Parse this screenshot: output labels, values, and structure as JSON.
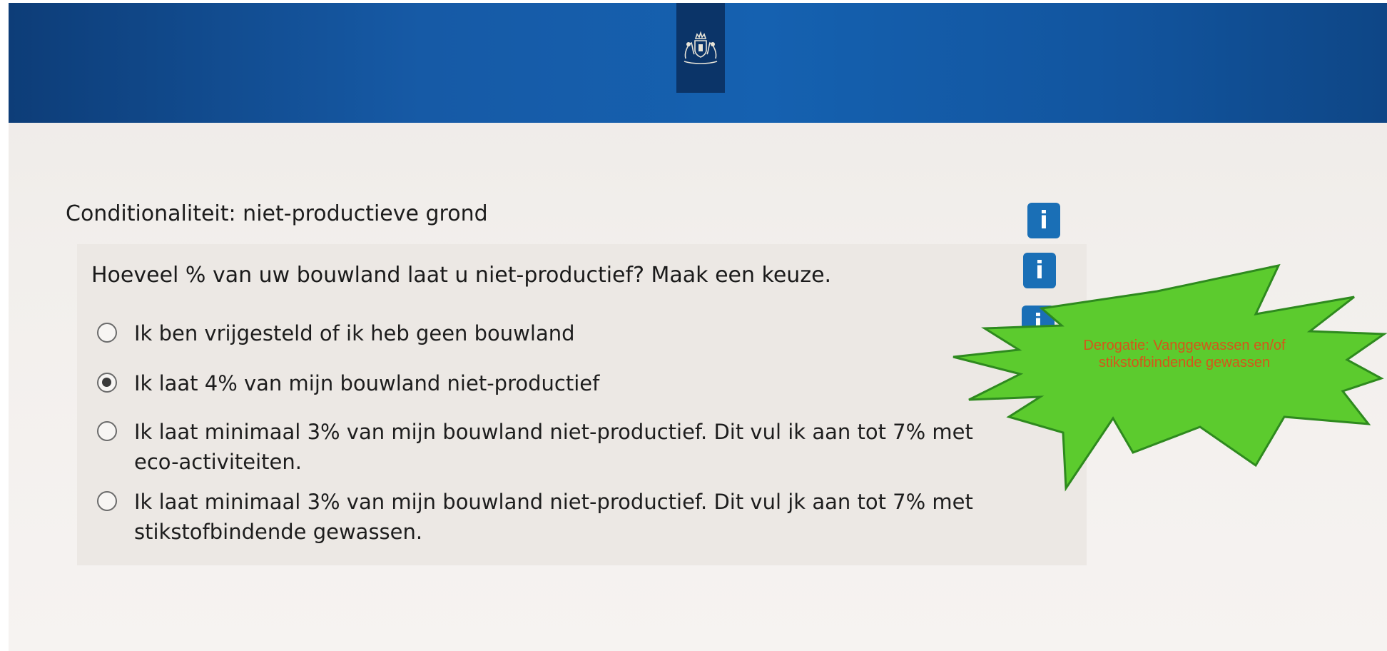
{
  "header": {
    "logo": "rijksoverheid-coat-of-arms-icon",
    "colors": {
      "bar": "#165aa6",
      "logo_bg": "#0b3468"
    }
  },
  "section": {
    "title": "Conditionaliteit: niet-productieve grond"
  },
  "question": {
    "text": "Hoeveel % van uw bouwland laat u niet-productief? Maak een keuze.",
    "options": [
      {
        "label": "Ik ben vrijgesteld of ik heb geen bouwland",
        "selected": false
      },
      {
        "label": "Ik laat 4% van mijn bouwland niet-productief",
        "selected": true
      },
      {
        "label": "Ik laat minimaal 3% van mijn bouwland niet-productief. Dit vul ik aan tot 7% met eco-activiteiten.",
        "selected": false
      },
      {
        "label": "Ik laat minimaal 3% van mijn bouwland niet-productief. Dit vul jk aan tot 7% met stikstofbindende gewassen.",
        "selected": false
      }
    ]
  },
  "info_buttons": [
    "i",
    "i",
    "i"
  ],
  "annotation": {
    "text": "Derogatie: Vanggewassen en/of stikstofbindende gewassen",
    "fill_color": "#5ccb2e",
    "text_color": "#d4561a"
  }
}
